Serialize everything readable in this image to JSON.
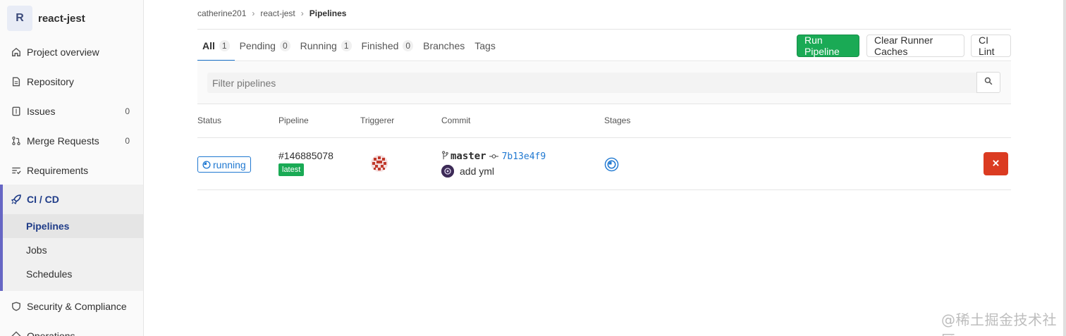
{
  "project": {
    "avatar_letter": "R",
    "name": "react-jest"
  },
  "sidebar": {
    "items": [
      {
        "label": "Project overview",
        "icon": "home-icon"
      },
      {
        "label": "Repository",
        "icon": "document-icon"
      },
      {
        "label": "Issues",
        "icon": "issues-icon",
        "count": "0"
      },
      {
        "label": "Merge Requests",
        "icon": "merge-request-icon",
        "count": "0"
      },
      {
        "label": "Requirements",
        "icon": "requirements-icon"
      }
    ],
    "ci": {
      "label": "CI / CD",
      "icon": "rocket-icon",
      "subitems": [
        "Pipelines",
        "Jobs",
        "Schedules"
      ]
    },
    "after": [
      {
        "label": "Security & Compliance",
        "icon": "shield-icon"
      },
      {
        "label": "Operations",
        "icon": "cloud-icon"
      }
    ]
  },
  "breadcrumb": [
    "catherine201",
    "react-jest",
    "Pipelines"
  ],
  "tabs": [
    {
      "label": "All",
      "count": "1"
    },
    {
      "label": "Pending",
      "count": "0"
    },
    {
      "label": "Running",
      "count": "1"
    },
    {
      "label": "Finished",
      "count": "0"
    },
    {
      "label": "Branches"
    },
    {
      "label": "Tags"
    }
  ],
  "buttons": {
    "run_pipeline": "Run Pipeline",
    "clear_caches": "Clear Runner Caches",
    "ci_lint": "CI Lint"
  },
  "filter": {
    "placeholder": "Filter pipelines"
  },
  "table": {
    "headers": [
      "Status",
      "Pipeline",
      "Triggerer",
      "Commit",
      "Stages"
    ],
    "rows": [
      {
        "status": "running",
        "pipeline_id": "#146885078",
        "pipeline_tag": "latest",
        "branch": "master",
        "sha": "7b13e4f9",
        "message": "add yml"
      }
    ]
  },
  "colors": {
    "accent": "#1f78d1",
    "success": "#1aaa55",
    "danger": "#db3b21",
    "sidebar_active": "#6666c4"
  },
  "watermark": "@稀土掘金技术社区"
}
